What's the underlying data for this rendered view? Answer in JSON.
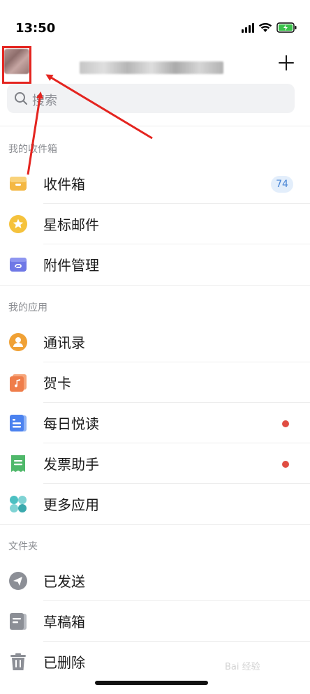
{
  "status_bar": {
    "time": "13:50"
  },
  "header": {
    "account_name": ""
  },
  "search": {
    "placeholder": "搜索"
  },
  "sections": {
    "mailbox_title": "我的收件箱",
    "apps_title": "我的应用",
    "folders_title": "文件夹"
  },
  "mailbox": [
    {
      "label": "收件箱",
      "icon": "inbox-icon",
      "badge": "74"
    },
    {
      "label": "星标邮件",
      "icon": "star-icon"
    },
    {
      "label": "附件管理",
      "icon": "attachment-icon"
    }
  ],
  "apps": [
    {
      "label": "通讯录",
      "icon": "contacts-icon"
    },
    {
      "label": "贺卡",
      "icon": "music-card-icon"
    },
    {
      "label": "每日悦读",
      "icon": "reading-icon",
      "dot": true
    },
    {
      "label": "发票助手",
      "icon": "invoice-icon",
      "dot": true
    },
    {
      "label": "更多应用",
      "icon": "more-apps-icon"
    }
  ],
  "folders": [
    {
      "label": "已发送",
      "icon": "sent-icon"
    },
    {
      "label": "草稿箱",
      "icon": "drafts-icon"
    },
    {
      "label": "已删除",
      "icon": "trash-icon"
    }
  ],
  "colors": {
    "annotation_red": "#e4241f",
    "badge_text": "#4a86d6",
    "badge_bg": "#e3eefb",
    "dot": "#e04d42"
  },
  "watermark": "Bai 经验"
}
